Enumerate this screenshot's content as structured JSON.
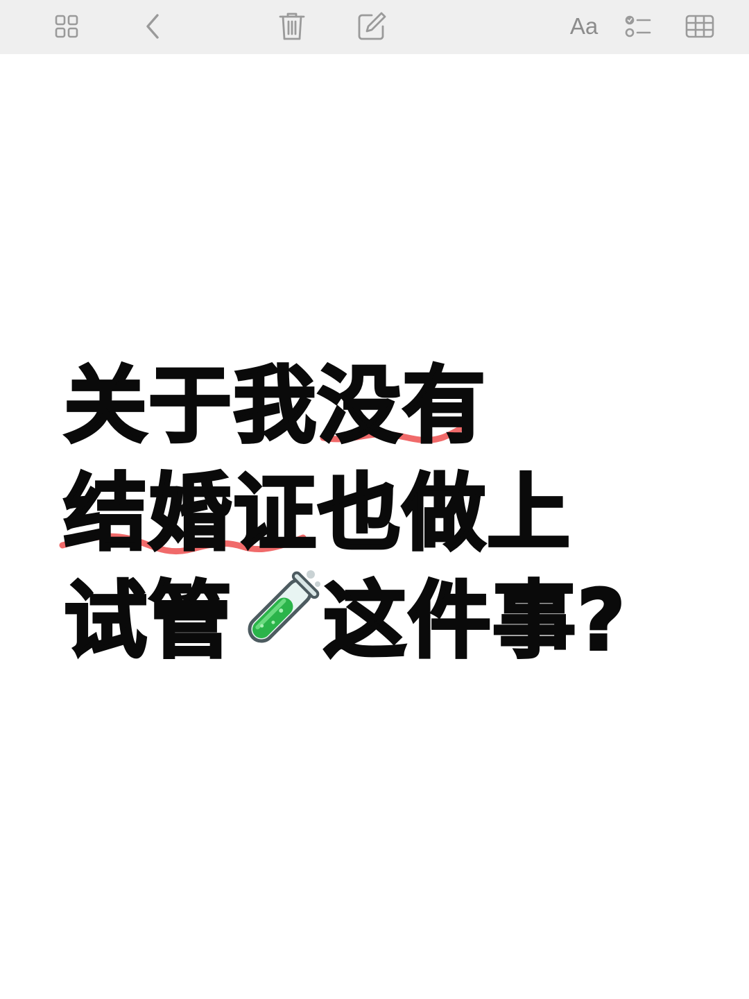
{
  "toolbar": {
    "icons": [
      "grid-icon",
      "chevron-left-icon",
      "trash-icon",
      "compose-icon",
      "text-format-icon",
      "checklist-icon",
      "table-icon"
    ],
    "format_label": "Aa"
  },
  "note": {
    "lines": [
      "关于我没有",
      "结婚证也做上",
      "试管",
      "这件事?"
    ],
    "emoji": "test-tube-icon",
    "highlight_color": "#f06a6a"
  }
}
